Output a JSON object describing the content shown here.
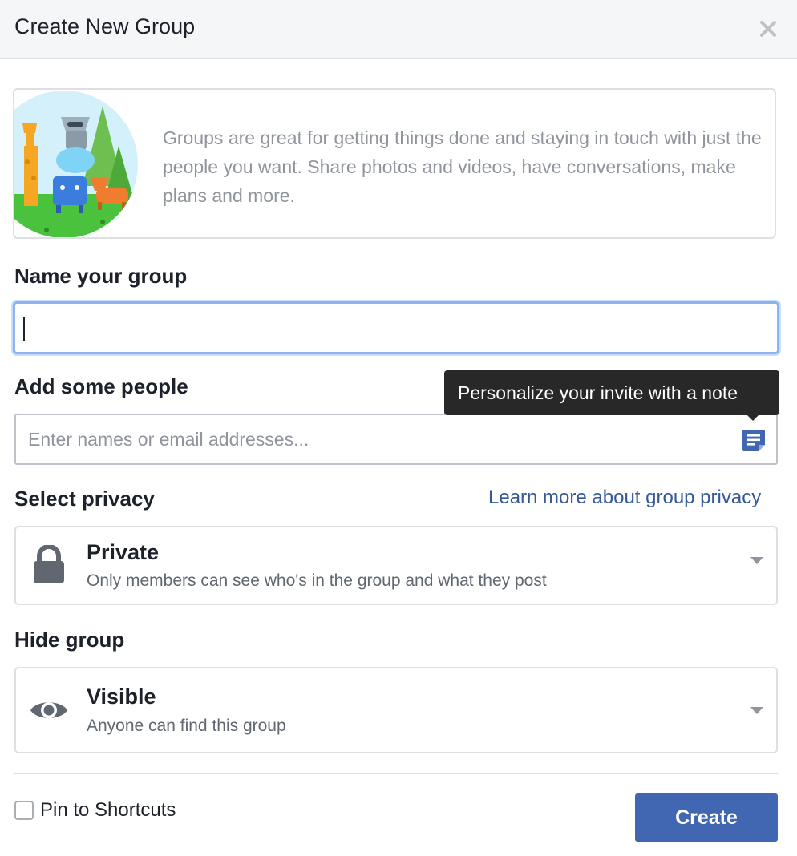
{
  "dialog": {
    "title": "Create New Group",
    "close_icon": "close-icon"
  },
  "intro": {
    "text": "Groups are great for getting things done and staying in touch with just the people you want. Share photos and videos, have conversations, make plans and more."
  },
  "name_section": {
    "label": "Name your group",
    "value": "",
    "placeholder": ""
  },
  "people_section": {
    "label": "Add some people",
    "placeholder": "Enter names or email addresses...",
    "note_icon": "note-icon",
    "tooltip": "Personalize your invite with a note"
  },
  "privacy_section": {
    "label": "Select privacy",
    "learn_more": "Learn more about group privacy",
    "selected_title": "Private",
    "selected_desc": "Only members can see who's in the group and what they post",
    "icon": "lock-icon"
  },
  "hide_section": {
    "label": "Hide group",
    "selected_title": "Visible",
    "selected_desc": "Anyone can find this group",
    "icon": "eye-icon"
  },
  "footer": {
    "pin_label": "Pin to Shortcuts",
    "pin_checked": false,
    "create_label": "Create"
  },
  "colors": {
    "primary_button": "#4267b2",
    "link": "#365899",
    "tooltip_bg": "#282828",
    "focus_border": "#8cb4f0"
  }
}
